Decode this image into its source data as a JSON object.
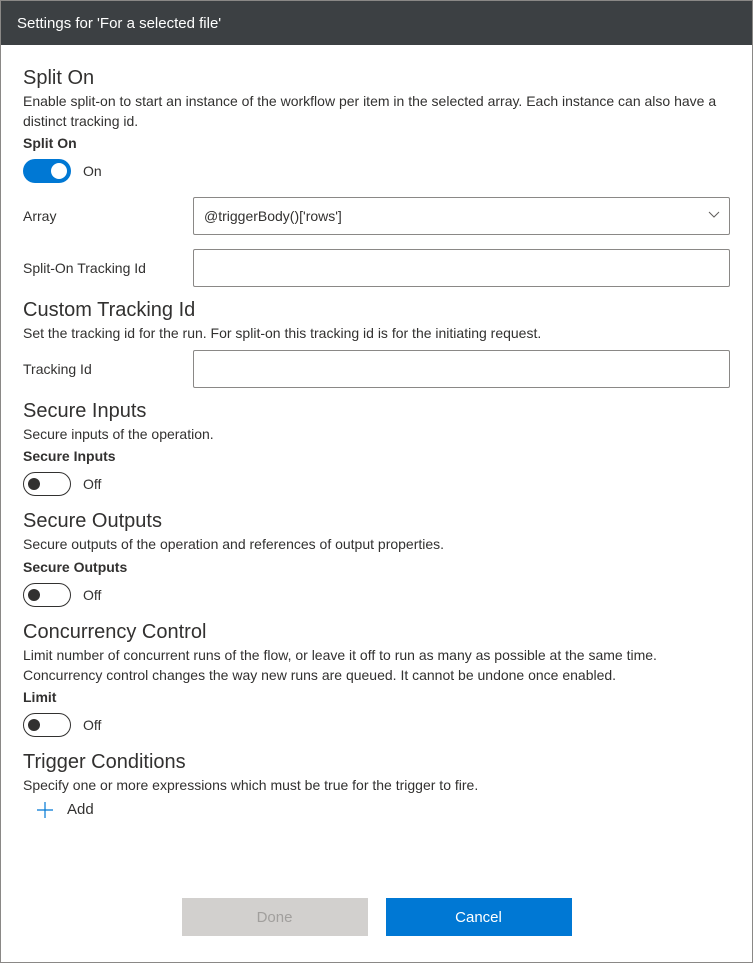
{
  "titlebar": {
    "title": "Settings for 'For a selected file'"
  },
  "splitOn": {
    "heading": "Split On",
    "desc": "Enable split-on to start an instance of the workflow per item in the selected array. Each instance can also have a distinct tracking id.",
    "toggleLabel": "Split On",
    "toggleState": "On",
    "arrayLabel": "Array",
    "arrayValue": "@triggerBody()['rows']",
    "trackingLabel": "Split-On Tracking Id",
    "trackingValue": ""
  },
  "customTracking": {
    "heading": "Custom Tracking Id",
    "desc": "Set the tracking id for the run. For split-on this tracking id is for the initiating request.",
    "label": "Tracking Id",
    "value": ""
  },
  "secureInputs": {
    "heading": "Secure Inputs",
    "desc": "Secure inputs of the operation.",
    "toggleLabel": "Secure Inputs",
    "toggleState": "Off"
  },
  "secureOutputs": {
    "heading": "Secure Outputs",
    "desc": "Secure outputs of the operation and references of output properties.",
    "toggleLabel": "Secure Outputs",
    "toggleState": "Off"
  },
  "concurrency": {
    "heading": "Concurrency Control",
    "desc": "Limit number of concurrent runs of the flow, or leave it off to run as many as possible at the same time. Concurrency control changes the way new runs are queued. It cannot be undone once enabled.",
    "toggleLabel": "Limit",
    "toggleState": "Off"
  },
  "triggerConditions": {
    "heading": "Trigger Conditions",
    "desc": "Specify one or more expressions which must be true for the trigger to fire.",
    "addLabel": "Add"
  },
  "footer": {
    "done": "Done",
    "cancel": "Cancel"
  }
}
